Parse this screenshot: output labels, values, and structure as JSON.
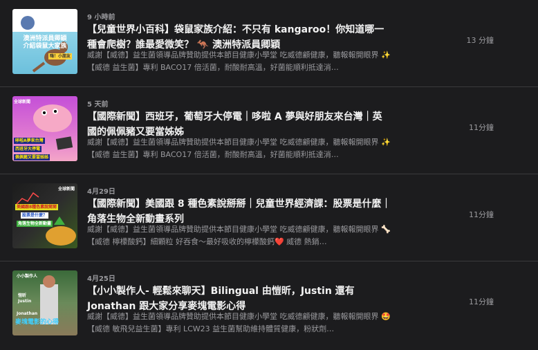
{
  "episodes": [
    {
      "date": "9 小時前",
      "title": "【兒童世界小百科】袋鼠家族介紹：不只有 kangaroo！你知道哪一種會爬樹？誰最愛微笑？ 🦘 澳洲特派員卿穎",
      "description": "威謝【威德】益生菌領導品牌贊助提供本節目健康小學堂 吃威德顧健康，聽報報開眼界 ✨【威德 益生菌】專利 BACO17 倍活菌，耐酸耐高溫，好菌能順利抵達消…",
      "duration": "13 分鐘",
      "thumb_text": [
        "澳洲特派員卿穎",
        "介紹袋鼠大家族",
        "嗨！小朋友"
      ]
    },
    {
      "date": "5 天前",
      "title": "【國際新聞】西班牙，葡萄牙大停電｜哆啦 A 夢與好朋友來台灣｜英國的佩佩豬又要當姊姊",
      "description": "威謝【威德】益生菌領導品牌贊助提供本節目健康小學堂 吃威德顧健康，聽報報開眼界 ✨【威德 益生菌】專利 BACO17 倍活菌，耐酸耐高溫，好菌能順利抵達消…",
      "duration": "11分鐘",
      "thumb_text": [
        "全球新聞",
        "哆啦A夢來台灣",
        "西班牙大停電",
        "佩佩豬又要當姊姊"
      ]
    },
    {
      "date": "4月29日",
      "title": "【國際新聞】美國跟 8 種色素說掰掰｜兒童世界經濟課：股票是什麼｜角落生物全新動畫系列",
      "description": "威謝【威德】益生菌領導品牌贊助提供本節目健康小學堂 吃威德顧健康，聽報報開眼界 🦴【威德 檸檬酸鈣】細顆粒 好吞食～最好吸收的檸檬酸鈣❤️ 威德 熱銷…",
      "duration": "11分鐘",
      "thumb_text": [
        "全球新聞",
        "美國跟8種色素說掰掰",
        "股票是什麼？",
        "角落生物全新動畫"
      ]
    },
    {
      "date": "4月25日",
      "title": "【小小製作人- 輕鬆來聊天】Bilingual 由愷昕，Justin 還有 Jonathan 跟大家分享麥塊電影心得",
      "description": "威謝【威德】益生菌領導品牌贊助提供本節目健康小學堂 吃威德顧健康，聽報報開眼界 🤩【威德 敏飛兒益生菌】專利 LCW23 益生菌幫助維持體質健康，粉狀劑…",
      "duration": "11分鐘",
      "thumb_text": [
        "小小製作人",
        "愷昕",
        "Justin",
        "Jonathan",
        "麥塊電影的心得"
      ]
    }
  ],
  "colors": {
    "background": "#1c1c1e",
    "divider": "#3a3a3c",
    "title": "#f2f2f2",
    "secondary": "#9a9a9e"
  }
}
